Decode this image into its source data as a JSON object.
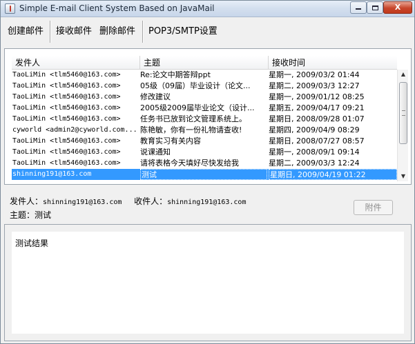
{
  "window": {
    "title": "Simple E-mail Client System Based on JavaMail",
    "minimize_glyph": "",
    "close_glyph": "X"
  },
  "toolbar": {
    "compose_label": "创建邮件",
    "receive_label": "接收邮件",
    "delete_label": "删除邮件",
    "settings_label": "POP3/SMTP设置"
  },
  "mail_list": {
    "columns": [
      "发件人",
      "主题",
      "接收时间"
    ],
    "rows": [
      {
        "sender": "TaoLiMin <tlm5460@163.com>",
        "subject": "Re:论文中期答辩ppt",
        "time": "星期一, 2009/03/2 01:44"
      },
      {
        "sender": "TaoLiMin <tlm5460@163.com>",
        "subject": "05级（09届）毕业设计（论文...",
        "time": "星期二, 2009/03/3 12:27"
      },
      {
        "sender": "TaoLiMin <tlm5460@163.com>",
        "subject": "修改建议",
        "time": "星期一, 2009/01/12 08:25"
      },
      {
        "sender": "TaoLiMin <tlm5460@163.com>",
        "subject": "2005级2009届毕业论文（设计...",
        "time": "星期五, 2009/04/17 09:21"
      },
      {
        "sender": "TaoLiMin <tlm5460@163.com>",
        "subject": "任务书已放到论文管理系统上。",
        "time": "星期日, 2008/09/28 01:07"
      },
      {
        "sender": "cyworld <admin2@cyworld.com...",
        "subject": "陈艳敏，你有一份礼物请查收!",
        "time": "星期四, 2009/04/9 08:29"
      },
      {
        "sender": "TaoLiMin <tlm5460@163.com>",
        "subject": "教育实习有关内容",
        "time": "星期日, 2008/07/27 08:57"
      },
      {
        "sender": "TaoLiMin <tlm5460@163.com>",
        "subject": "说课通知",
        "time": "星期一, 2008/09/1 09:14"
      },
      {
        "sender": "TaoLiMin <tlm5460@163.com>",
        "subject": "请将表格今天填好尽快发给我",
        "time": "星期二, 2009/03/3 12:24"
      },
      {
        "sender": "shinning191@163.com",
        "subject": "测试",
        "time": "星期日, 2009/04/19 01:22",
        "selected": true
      }
    ],
    "scrollbar_fraction_visible": 0.55
  },
  "mail_info": {
    "sender_label": "发件人：",
    "sender_value": "shinning191@163.com",
    "recipient_label": "收件人：",
    "recipient_value": "shinning191@163.com",
    "subject_label": "主题：",
    "subject_value": "测试",
    "attachment_button": "附件"
  },
  "mail_body": {
    "text": "测试结果"
  }
}
